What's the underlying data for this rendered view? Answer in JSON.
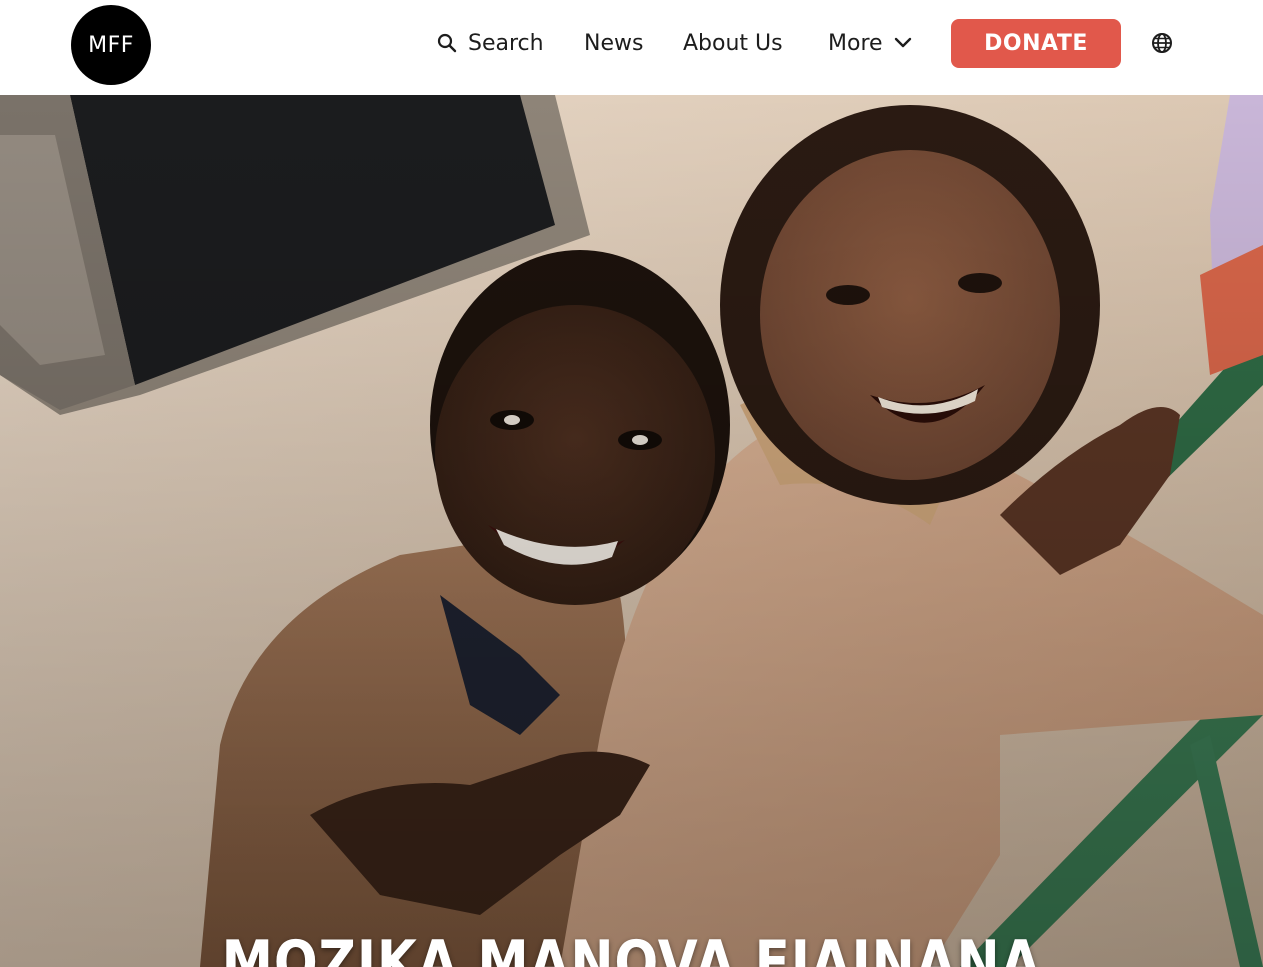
{
  "header": {
    "logo_text": "MFF",
    "nav": {
      "search_label": "Search",
      "news_label": "News",
      "about_label": "About Us",
      "more_label": "More"
    },
    "donate_label": "DONATE"
  },
  "hero": {
    "title": "MOZIKA MANOVA FIAINANA"
  },
  "icons": {
    "search": "search-icon",
    "chevron": "chevron-down-icon",
    "globe": "globe-icon"
  },
  "colors": {
    "donate": "#e1584b",
    "logo_bg": "#000000",
    "nav_text": "#1d1d1d"
  }
}
